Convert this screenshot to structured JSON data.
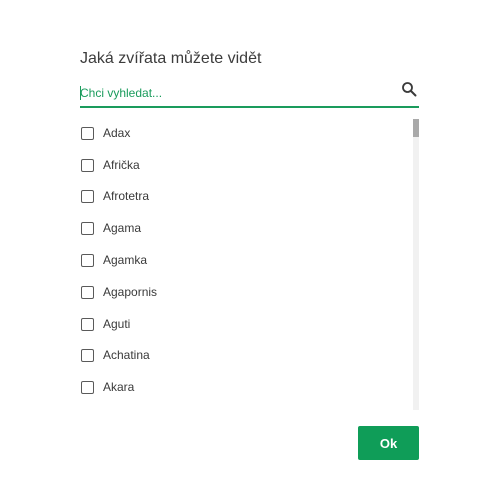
{
  "dialog": {
    "title": "Jaká zvířata můžete vidět",
    "search": {
      "placeholder": "Chci vyhledat...",
      "value": "",
      "icon": "search-icon"
    },
    "items": [
      {
        "label": "Adax",
        "checked": false
      },
      {
        "label": "Afrička",
        "checked": false
      },
      {
        "label": "Afrotetra",
        "checked": false
      },
      {
        "label": "Agama",
        "checked": false
      },
      {
        "label": "Agamka",
        "checked": false
      },
      {
        "label": "Agapornis",
        "checked": false
      },
      {
        "label": "Aguti",
        "checked": false
      },
      {
        "label": "Achatina",
        "checked": false
      },
      {
        "label": "Akara",
        "checked": false
      }
    ],
    "ok_label": "Ok",
    "colors": {
      "accent": "#0f9d58",
      "underline": "#1a9b5c"
    }
  }
}
